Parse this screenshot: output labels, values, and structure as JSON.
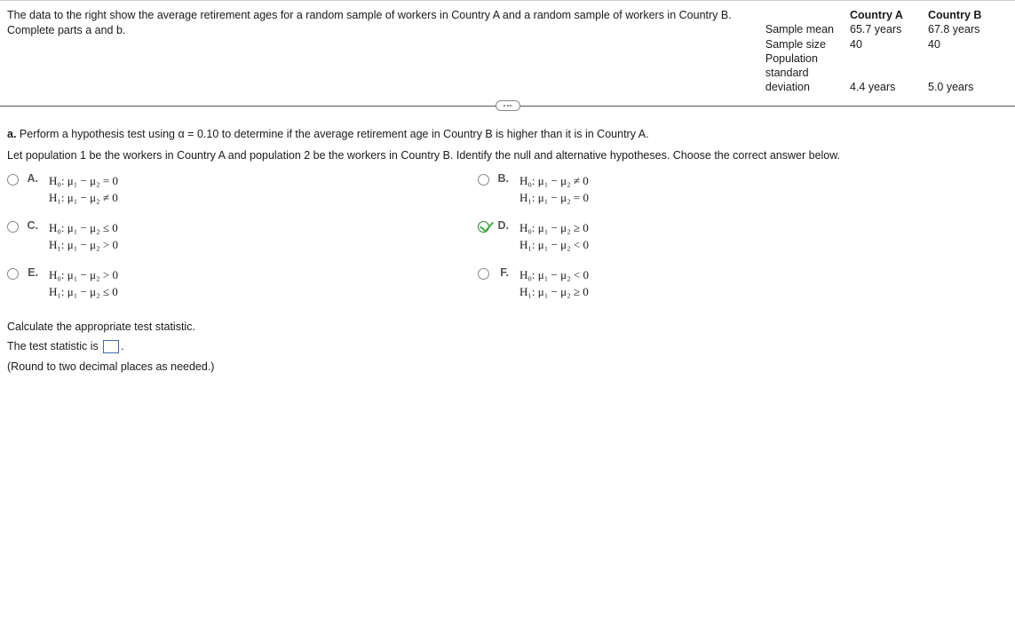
{
  "header": {
    "problem_text": "The data to the right show the average retirement ages for a random sample of workers in Country A and a random sample of workers in Country B. Complete parts a and b.",
    "table": {
      "rows": [
        {
          "label": "Sample mean"
        },
        {
          "label": "Sample size"
        },
        {
          "label": "Population standard deviation"
        }
      ],
      "colA": {
        "header": "Country A",
        "mean": "65.7 years",
        "size": "40",
        "psd": "4.4 years"
      },
      "colB": {
        "header": "Country B",
        "mean": "67.8 years",
        "size": "40",
        "psd": "5.0 years"
      }
    }
  },
  "part_a": {
    "prompt1_prefix": "a.",
    "prompt1_text": " Perform a hypothesis test using α = 0.10 to determine if the average retirement age in Country B is higher than it is in Country A.",
    "prompt2": "Let population 1 be the workers in Country A and population 2 be the workers in Country B. Identify the null and alternative hypotheses. Choose the correct answer below.",
    "options": [
      {
        "letter": "A.",
        "h0": "H₀: μ₁ − μ₂ = 0",
        "h1": "H₁: μ₁ − μ₂ ≠ 0",
        "selected": false
      },
      {
        "letter": "B.",
        "h0": "H₀: μ₁ − μ₂ ≠ 0",
        "h1": "H₁: μ₁ − μ₂ = 0",
        "selected": false
      },
      {
        "letter": "C.",
        "h0": "H₀: μ₁ − μ₂ ≤ 0",
        "h1": "H₁: μ₁ − μ₂ > 0",
        "selected": false
      },
      {
        "letter": "D.",
        "h0": "H₀: μ₁ − μ₂ ≥ 0",
        "h1": "H₁: μ₁ − μ₂ < 0",
        "selected": true
      },
      {
        "letter": "E.",
        "h0": "H₀: μ₁ − μ₂ > 0",
        "h1": "H₁: μ₁ − μ₂ ≤ 0",
        "selected": false
      },
      {
        "letter": "F.",
        "h0": "H₀: μ₁ − μ₂ < 0",
        "h1": "H₁: μ₁ − μ₂ ≥ 0",
        "selected": false
      }
    ],
    "calc_prompt": "Calculate the appropriate test statistic.",
    "stat_prefix": "The test statistic is ",
    "stat_suffix": ".",
    "round_note": "(Round to two decimal places as needed.)"
  }
}
